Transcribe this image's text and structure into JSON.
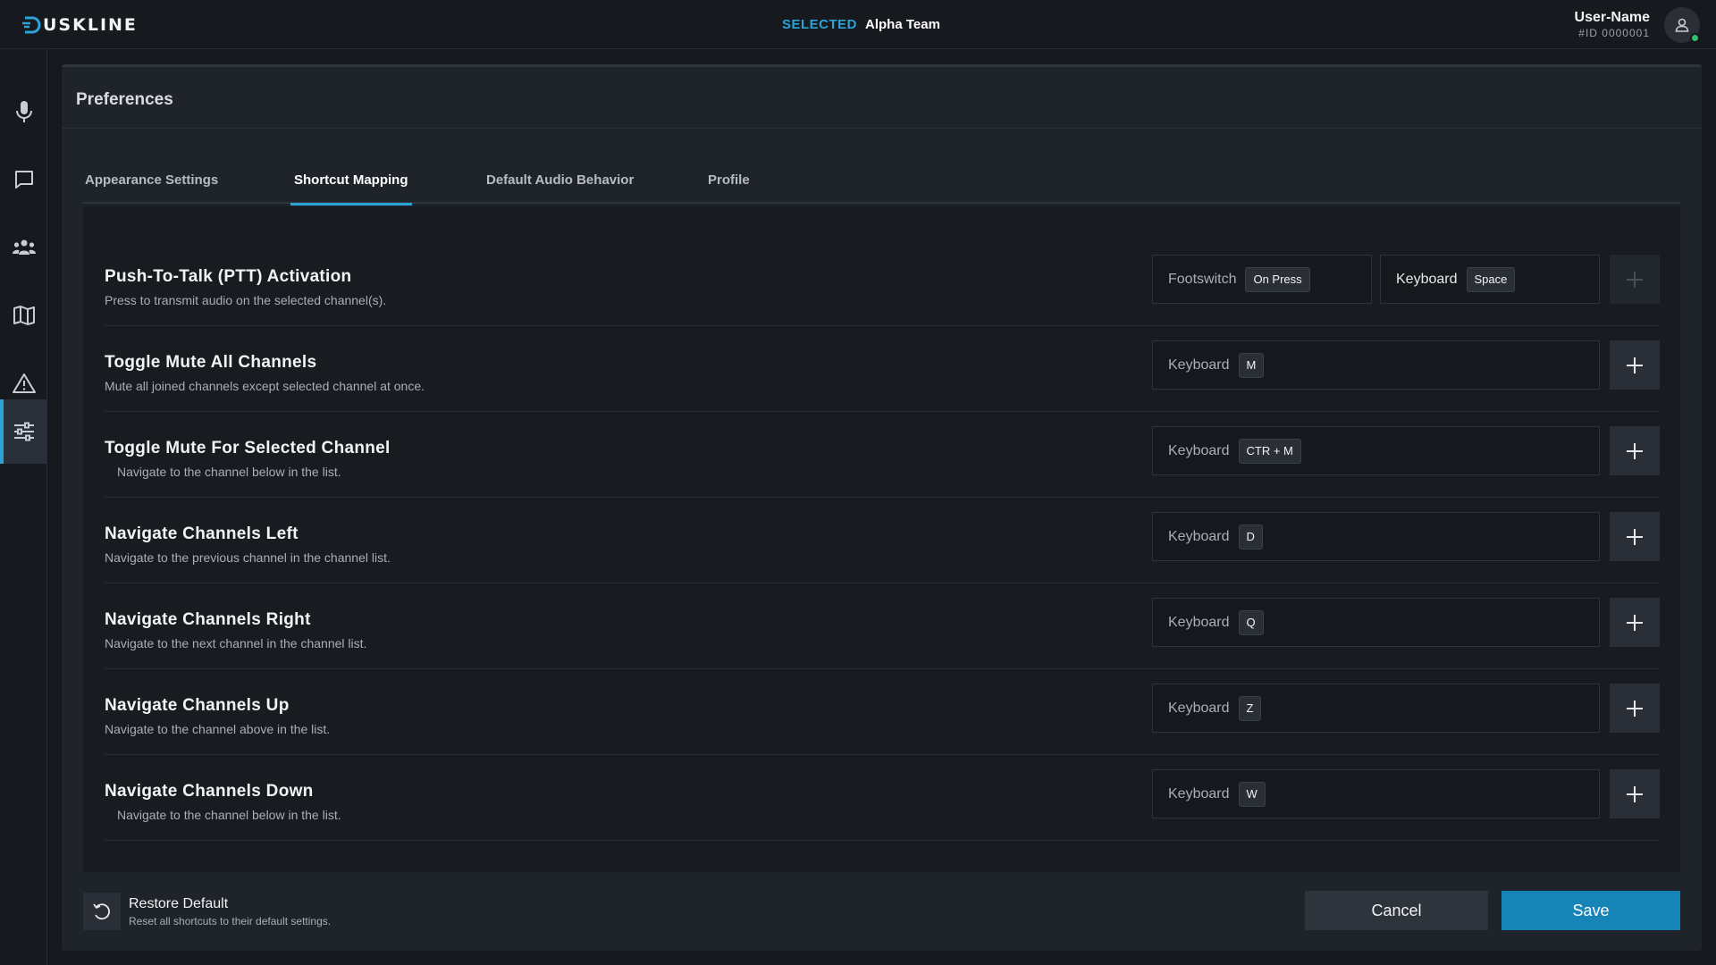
{
  "header": {
    "logo_text": "USKLINE",
    "selected_label": "SELECTED",
    "selected_value": "Alpha Team",
    "user_name": "User-Name",
    "user_id": "#ID 0000001"
  },
  "sidebar": {
    "items": [
      {
        "icon": "microphone-icon"
      },
      {
        "icon": "chat-icon"
      },
      {
        "icon": "team-icon"
      },
      {
        "icon": "map-icon"
      },
      {
        "icon": "warning-icon"
      },
      {
        "icon": "sliders-icon",
        "active": true
      }
    ]
  },
  "panel": {
    "title": "Preferences",
    "tabs": [
      {
        "label": "Appearance Settings"
      },
      {
        "label": "Shortcut Mapping",
        "active": true
      },
      {
        "label": "Default Audio Behavior"
      },
      {
        "label": "Profile"
      }
    ]
  },
  "shortcuts": [
    {
      "title": "Push-To-Talk (PTT) Activation",
      "desc": "Press to transmit audio on the selected channel(s).",
      "bindings": [
        {
          "source": "Footswitch",
          "key": "On Press"
        },
        {
          "source": "Keyboard",
          "key": "Space"
        }
      ]
    },
    {
      "title": "Toggle Mute All Channels",
      "desc": "Mute all joined channels except selected channel at once.",
      "bindings": [
        {
          "source": "Keyboard",
          "key": "M"
        }
      ]
    },
    {
      "title": "Toggle Mute For Selected Channel",
      "desc": "Navigate to the channel below in the list.",
      "bindings": [
        {
          "source": "Keyboard",
          "key": "CTR + M"
        }
      ]
    },
    {
      "title": "Navigate Channels Left",
      "desc": "Navigate to the previous channel in the channel list.",
      "bindings": [
        {
          "source": "Keyboard",
          "key": "D"
        }
      ]
    },
    {
      "title": "Navigate Channels Right",
      "desc": "Navigate to the next channel in the channel list.",
      "bindings": [
        {
          "source": "Keyboard",
          "key": "Q"
        }
      ]
    },
    {
      "title": "Navigate Channels Up",
      "desc": "Navigate to the channel above in the list.",
      "bindings": [
        {
          "source": "Keyboard",
          "key": "Z"
        }
      ]
    },
    {
      "title": "Navigate Channels Down",
      "desc": "Navigate to the channel below in the list.",
      "bindings": [
        {
          "source": "Keyboard",
          "key": "W"
        }
      ]
    }
  ],
  "footer": {
    "restore_title": "Restore Default",
    "restore_desc": "Reset all shortcuts to their default settings.",
    "cancel_label": "Cancel",
    "save_label": "Save"
  },
  "colors": {
    "accent": "#2ba3d6",
    "save_button": "#1784b8",
    "online_status": "#33c06a"
  }
}
